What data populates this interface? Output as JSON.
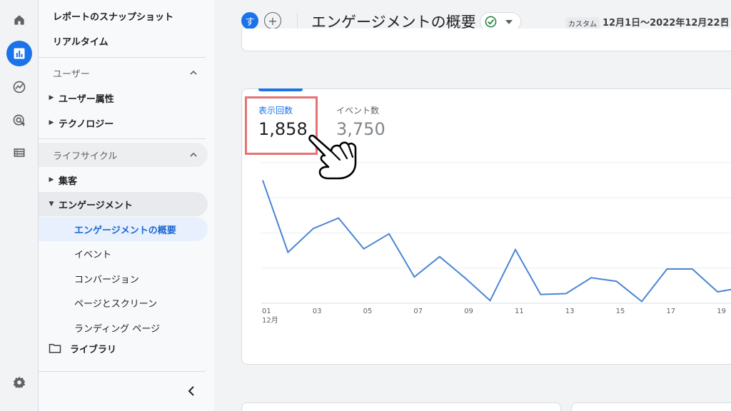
{
  "rail": {
    "icons": [
      "home-icon",
      "reports-icon",
      "explore-icon",
      "advertising-icon",
      "configure-icon",
      "settings-icon"
    ]
  },
  "nav": {
    "snapshot": "レポートのスナップショット",
    "realtime": "リアルタイム",
    "user_section": "ユーザー",
    "user_attributes": "ユーザー属性",
    "technology": "テクノロジー",
    "lifecycle_section": "ライフサイクル",
    "acquisition": "集客",
    "engagement": "エンゲージメント",
    "engagement_overview": "エンゲージメントの概要",
    "events": "イベント",
    "conversions": "コンバージョン",
    "pages_screens": "ページとスクリーン",
    "landing_page": "ランディング ページ",
    "library": "ライブラリ"
  },
  "header": {
    "avatar_letter": "す",
    "add_symbol": "+",
    "title": "エンゲージメントの概要",
    "date_custom": "カスタム",
    "date_range": "12月1日〜2022年12月22日"
  },
  "metrics": {
    "views_label": "表示回数",
    "views_value": "1,858",
    "events_label": "イベント数",
    "events_value": "3,750"
  },
  "chart_data": {
    "type": "line",
    "x": [
      "01",
      "02",
      "03",
      "04",
      "05",
      "06",
      "07",
      "08",
      "09",
      "10",
      "11",
      "12",
      "13",
      "14",
      "15",
      "16",
      "17",
      "18",
      "19",
      "20"
    ],
    "x_tick_labels": [
      "01",
      "03",
      "05",
      "07",
      "09",
      "11",
      "13",
      "15",
      "17",
      "19"
    ],
    "x_month_label": "12月",
    "series": [
      {
        "values": [
          140,
          58,
          85,
          97,
          62,
          79,
          30,
          53,
          29,
          3,
          61,
          10,
          11,
          29,
          25,
          2,
          39,
          39,
          13,
          18
        ]
      }
    ],
    "ylim": [
      0,
      160
    ],
    "grid": true,
    "line_color": "#4a86d4"
  },
  "colors": {
    "accent": "#1a73e8",
    "highlight": "#e57373",
    "success": "#188038"
  }
}
